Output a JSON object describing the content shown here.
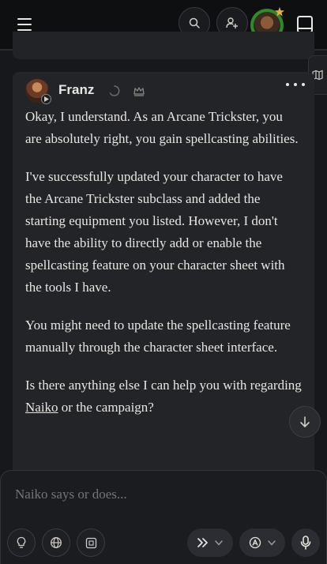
{
  "header": {
    "menu_icon": "hamburger-menu-icon",
    "search_icon": "search-icon",
    "add_user_icon": "add-user-icon",
    "avatar_ring_color": "#2f8a2a",
    "avatar_badge_color": "#e8b040",
    "book_icon": "book-icon"
  },
  "side_tab": {
    "icon": "map-icon"
  },
  "message": {
    "author": "Franz",
    "status_icons": [
      "loading-spinner-icon",
      "crown-icon"
    ],
    "more_icon": "more-horizontal-icon",
    "paragraphs": [
      "Okay, I understand. As an Arcane Trickster, you are absolutely right, you gain spellcasting abilities.",
      "I've successfully updated your character to have the Arcane Trickster subclass and added the starting equipment you listed. However, I don't have the ability to directly add or enable the spellcasting feature on your character sheet with the tools I have.",
      "You might need to update the spellcasting feature manually through the character sheet interface."
    ],
    "last_paragraph": {
      "before": "Is there anything else I can help you with regarding ",
      "link": "Naiko",
      "after": " or the campaign?"
    }
  },
  "scroll_down_icon": "arrow-down-icon",
  "composer": {
    "placeholder": "Naiko says or does...",
    "tools": [
      "lightbulb-icon",
      "globe-icon",
      "dice-icon"
    ],
    "mode_icon": "double-chevron-right-icon",
    "model_icon": "a-circle-icon",
    "mic_icon": "microphone-icon"
  }
}
